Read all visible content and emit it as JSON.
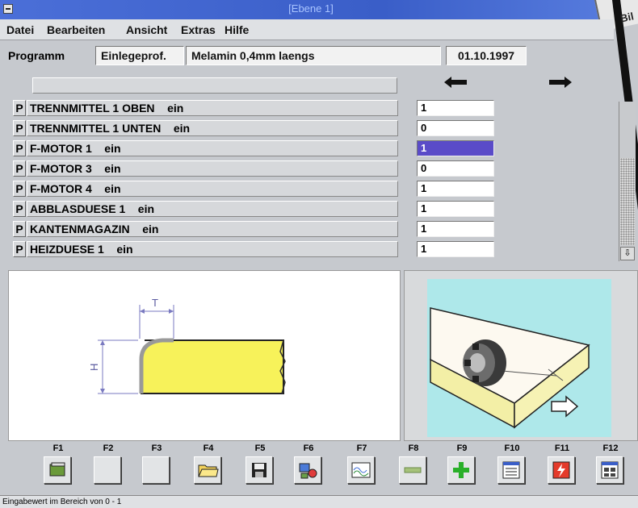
{
  "window": {
    "title": "[Ebene 1]",
    "peek_label": "Bil"
  },
  "menu": {
    "items": [
      "Datei",
      "Bearbeiten",
      "Ansicht",
      "Extras",
      "Hilfe"
    ]
  },
  "program": {
    "label": "Programm",
    "type": "Einlegeprof.",
    "description": "Melamin 0,4mm laengs",
    "date": "01.10.1997"
  },
  "params": {
    "rows": [
      {
        "p": "P",
        "label": "TRENNMITTEL 1 OBEN    ein",
        "value": "1"
      },
      {
        "p": "P",
        "label": "TRENNMITTEL 1 UNTEN    ein",
        "value": "0"
      },
      {
        "p": "P",
        "label": "F-MOTOR 1    ein",
        "value": "1"
      },
      {
        "p": "P",
        "label": "F-MOTOR 3    ein",
        "value": "0"
      },
      {
        "p": "P",
        "label": "F-MOTOR 4    ein",
        "value": "1"
      },
      {
        "p": "P",
        "label": "ABBLASDUESE 1    ein",
        "value": "1"
      },
      {
        "p": "P",
        "label": "KANTENMAGAZIN    ein",
        "value": "1"
      },
      {
        "p": "P",
        "label": "HEIZDUESE 1    ein",
        "value": "1"
      }
    ],
    "active_index": 2
  },
  "drawing": {
    "dim_t": "T",
    "dim_h": "H"
  },
  "fkeys": [
    {
      "label": "F1",
      "icon": "book-icon"
    },
    {
      "label": "F2",
      "icon": ""
    },
    {
      "label": "F3",
      "icon": ""
    },
    {
      "label": "F4",
      "icon": "open-folder-icon"
    },
    {
      "label": "F5",
      "icon": "floppy-disk-icon"
    },
    {
      "label": "F6",
      "icon": "tools-icon"
    },
    {
      "label": "F7",
      "icon": "wave-chart-icon"
    },
    {
      "label": "F8",
      "icon": "minus-icon"
    },
    {
      "label": "F9",
      "icon": "plus-icon"
    },
    {
      "label": "F10",
      "icon": "list-window-icon"
    },
    {
      "label": "F11",
      "icon": "lightning-stop-icon"
    },
    {
      "label": "F12",
      "icon": "grid-window-icon"
    }
  ],
  "status": {
    "text": "Eingabewert im Bereich von 0 - 1"
  },
  "colors": {
    "title_bar": "#3a5ec8",
    "active_value": "#5a4bc8",
    "profile_yellow": "#f7f25a",
    "preview_bg": "#aee8ea"
  }
}
